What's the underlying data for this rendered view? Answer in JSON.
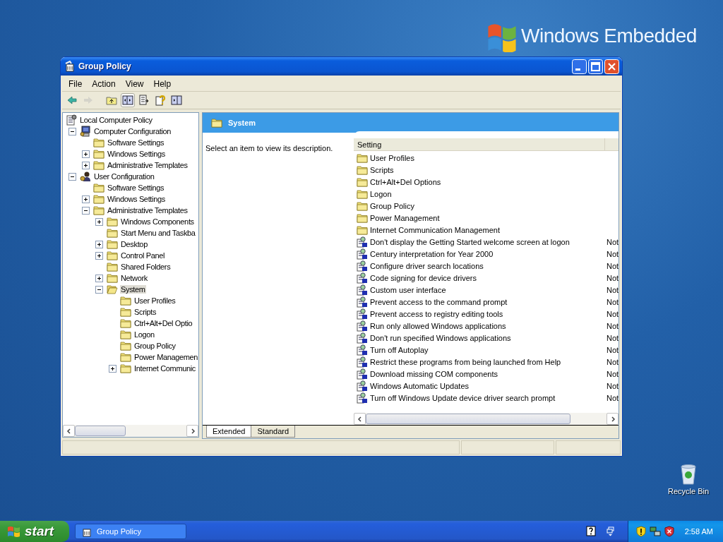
{
  "desktop": {
    "logo_text": "Windows Embedded",
    "icons": [
      {
        "label": "Recycle Bin",
        "kind": "recycle"
      }
    ]
  },
  "window": {
    "title": "Group Policy"
  },
  "menu": [
    "File",
    "Action",
    "View",
    "Help"
  ],
  "toolbar": [
    {
      "kind": "back",
      "disabled": false,
      "pressed": false
    },
    {
      "kind": "forward",
      "disabled": true,
      "pressed": false
    },
    {
      "kind": "up",
      "disabled": false,
      "pressed": false
    },
    {
      "kind": "tree",
      "disabled": false,
      "pressed": true
    },
    {
      "kind": "export",
      "disabled": false,
      "pressed": false
    },
    {
      "kind": "help",
      "disabled": false,
      "pressed": false
    },
    {
      "kind": "pane",
      "disabled": false,
      "pressed": false
    }
  ],
  "tree": [
    {
      "label": "Local Computer Policy",
      "kind": "policy",
      "selected": false,
      "children": [
        {
          "label": "Computer Configuration",
          "kind": "computer",
          "expanded": true,
          "selected": false,
          "children": [
            {
              "label": "Software Settings",
              "kind": "folder",
              "selected": false
            },
            {
              "label": "Windows Settings",
              "kind": "folder",
              "expanded": false,
              "selected": false
            },
            {
              "label": "Administrative Templates",
              "kind": "folder",
              "expanded": false,
              "selected": false
            }
          ]
        },
        {
          "label": "User Configuration",
          "kind": "user",
          "expanded": true,
          "selected": false,
          "children": [
            {
              "label": "Software Settings",
              "kind": "folder",
              "selected": false
            },
            {
              "label": "Windows Settings",
              "kind": "folder",
              "expanded": false,
              "selected": false
            },
            {
              "label": "Administrative Templates",
              "kind": "folder",
              "expanded": true,
              "selected": false,
              "children": [
                {
                  "label": "Windows Components",
                  "kind": "folder",
                  "expanded": false,
                  "selected": false
                },
                {
                  "label": "Start Menu and Taskba",
                  "kind": "folder",
                  "selected": false
                },
                {
                  "label": "Desktop",
                  "kind": "folder",
                  "expanded": false,
                  "selected": false
                },
                {
                  "label": "Control Panel",
                  "kind": "folder",
                  "expanded": false,
                  "selected": false
                },
                {
                  "label": "Shared Folders",
                  "kind": "folder",
                  "selected": false
                },
                {
                  "label": "Network",
                  "kind": "folder",
                  "expanded": false,
                  "selected": false
                },
                {
                  "label": "System",
                  "kind": "folder",
                  "expanded": true,
                  "selected": true,
                  "children": [
                    {
                      "label": "User Profiles",
                      "kind": "folder",
                      "selected": false
                    },
                    {
                      "label": "Scripts",
                      "kind": "folder",
                      "selected": false
                    },
                    {
                      "label": "Ctrl+Alt+Del Optio",
                      "kind": "folder",
                      "selected": false
                    },
                    {
                      "label": "Logon",
                      "kind": "folder",
                      "selected": false
                    },
                    {
                      "label": "Group Policy",
                      "kind": "folder",
                      "selected": false
                    },
                    {
                      "label": "Power Managemen",
                      "kind": "folder",
                      "selected": false
                    },
                    {
                      "label": "Internet Communic",
                      "kind": "folder",
                      "expanded": false,
                      "selected": false
                    }
                  ]
                }
              ]
            }
          ]
        }
      ]
    }
  ],
  "details": {
    "title": "System",
    "description": "Select an item to view its description.",
    "columns": [
      "Setting"
    ],
    "rows": [
      {
        "kind": "folder",
        "name": "User Profiles",
        "selected": false
      },
      {
        "kind": "folder",
        "name": "Scripts",
        "selected": false
      },
      {
        "kind": "folder",
        "name": "Ctrl+Alt+Del Options",
        "selected": false
      },
      {
        "kind": "folder",
        "name": "Logon",
        "selected": false
      },
      {
        "kind": "folder",
        "name": "Group Policy",
        "selected": false
      },
      {
        "kind": "folder",
        "name": "Power Management",
        "selected": false
      },
      {
        "kind": "folder",
        "name": "Internet Communication Management",
        "selected": false
      },
      {
        "kind": "setting",
        "name": "Don't display the Getting Started welcome screen at logon",
        "state": "Not",
        "selected": false
      },
      {
        "kind": "setting",
        "name": "Century interpretation for Year 2000",
        "state": "Not",
        "selected": false
      },
      {
        "kind": "setting",
        "name": "Configure driver search locations",
        "state": "Not",
        "selected": false
      },
      {
        "kind": "setting",
        "name": "Code signing for device drivers",
        "state": "Not",
        "selected": false
      },
      {
        "kind": "setting",
        "name": "Custom user interface",
        "state": "Not",
        "selected": false
      },
      {
        "kind": "setting",
        "name": "Prevent access to the command prompt",
        "state": "Not",
        "selected": false
      },
      {
        "kind": "setting",
        "name": "Prevent access to registry editing tools",
        "state": "Not",
        "selected": false
      },
      {
        "kind": "setting",
        "name": "Run only allowed Windows applications",
        "state": "Not",
        "selected": false
      },
      {
        "kind": "setting",
        "name": "Don't run specified Windows applications",
        "state": "Not",
        "selected": false
      },
      {
        "kind": "setting",
        "name": "Turn off Autoplay",
        "state": "Not",
        "selected": false
      },
      {
        "kind": "setting",
        "name": "Restrict these programs from being launched from Help",
        "state": "Not",
        "selected": false
      },
      {
        "kind": "setting",
        "name": "Download missing COM components",
        "state": "Not",
        "selected": false
      },
      {
        "kind": "setting",
        "name": "Windows Automatic Updates",
        "state": "Not",
        "selected": false
      },
      {
        "kind": "setting",
        "name": "Turn off Windows Update device driver search prompt",
        "state": "Not",
        "selected": false
      }
    ],
    "tabs": [
      {
        "label": "Extended",
        "selected": true
      },
      {
        "label": "Standard",
        "selected": false
      }
    ]
  },
  "taskbar": {
    "start": "start",
    "tasks": [
      {
        "label": "Group Policy",
        "selected": false
      }
    ],
    "tray": [
      {
        "kind": "help"
      },
      {
        "kind": "restore"
      },
      {
        "kind": "shield-warning"
      },
      {
        "kind": "network"
      },
      {
        "kind": "shield-alert"
      }
    ],
    "clock": "2:58 AM"
  }
}
